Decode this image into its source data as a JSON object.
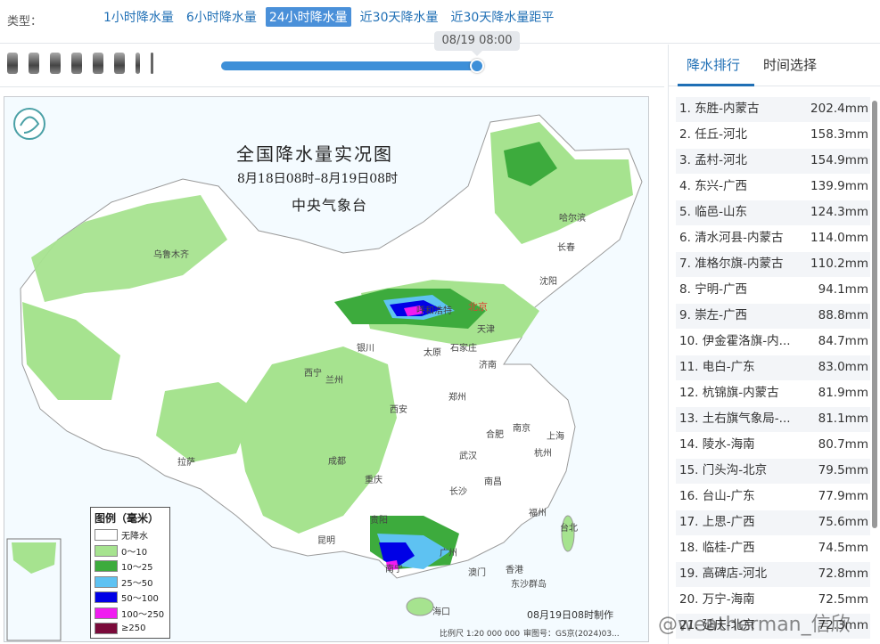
{
  "header": {
    "type_label": "类型：",
    "tabs": [
      {
        "label": "1小时降水量",
        "active": false
      },
      {
        "label": "6小时降水量",
        "active": false
      },
      {
        "label": "24小时降水量",
        "active": true
      },
      {
        "label": "近30天降水量",
        "active": false
      },
      {
        "label": "近30天降水量距平",
        "active": false
      }
    ]
  },
  "timeline": {
    "current_time": "08/19 08:00",
    "progress": 0.99
  },
  "map": {
    "title": "全国降水量实况图",
    "subtitle": "8月18日08时–8月19日08时",
    "agency": "中央气象台",
    "legend_title": "图例（毫米）",
    "legend": [
      {
        "label": "无降水",
        "color": "#ffffff"
      },
      {
        "label": "0～10",
        "color": "#a6e38f"
      },
      {
        "label": "10～25",
        "color": "#3dab3d"
      },
      {
        "label": "25～50",
        "color": "#5ec2f2"
      },
      {
        "label": "50～100",
        "color": "#0000e6"
      },
      {
        "label": "100～250",
        "color": "#f01cf0"
      },
      {
        "label": "≥250",
        "color": "#7a0a3a"
      }
    ],
    "cities": [
      {
        "name": "哈尔滨",
        "cap": false
      },
      {
        "name": "长春",
        "cap": false
      },
      {
        "name": "沈阳",
        "cap": false
      },
      {
        "name": "北京",
        "cap": true
      },
      {
        "name": "天津",
        "cap": false
      },
      {
        "name": "呼和浩特",
        "cap": false
      },
      {
        "name": "石家庄",
        "cap": false
      },
      {
        "name": "太原",
        "cap": false
      },
      {
        "name": "济南",
        "cap": false
      },
      {
        "name": "银川",
        "cap": false
      },
      {
        "name": "西宁",
        "cap": false
      },
      {
        "name": "兰州",
        "cap": false
      },
      {
        "name": "乌鲁木齐",
        "cap": false
      },
      {
        "name": "郑州",
        "cap": false
      },
      {
        "name": "西安",
        "cap": false
      },
      {
        "name": "南京",
        "cap": false
      },
      {
        "name": "合肥",
        "cap": false
      },
      {
        "name": "上海",
        "cap": false
      },
      {
        "name": "武汉",
        "cap": false
      },
      {
        "name": "杭州",
        "cap": false
      },
      {
        "name": "成都",
        "cap": false
      },
      {
        "name": "重庆",
        "cap": false
      },
      {
        "name": "拉萨",
        "cap": false
      },
      {
        "name": "长沙",
        "cap": false
      },
      {
        "name": "南昌",
        "cap": false
      },
      {
        "name": "福州",
        "cap": false
      },
      {
        "name": "台北",
        "cap": false
      },
      {
        "name": "贵阳",
        "cap": false
      },
      {
        "name": "昆明",
        "cap": false
      },
      {
        "name": "南宁",
        "cap": false
      },
      {
        "name": "广州",
        "cap": false
      },
      {
        "name": "澳门",
        "cap": false
      },
      {
        "name": "香港",
        "cap": false
      },
      {
        "name": "海口",
        "cap": false
      },
      {
        "name": "东沙群岛",
        "cap": false
      }
    ],
    "made_time": "08月19日08时制作",
    "scale": "比例尺 1:20 000 000",
    "approval": "审图号：GS京(2024)03..."
  },
  "side": {
    "tabs": [
      {
        "label": "降水排行",
        "active": true
      },
      {
        "label": "时间选择",
        "active": false
      }
    ],
    "ranking": [
      {
        "rank": "1.",
        "name": "东胜-内蒙古",
        "value": "202.4mm"
      },
      {
        "rank": "2.",
        "name": "任丘-河北",
        "value": "158.3mm"
      },
      {
        "rank": "3.",
        "name": "孟村-河北",
        "value": "154.9mm"
      },
      {
        "rank": "4.",
        "name": "东兴-广西",
        "value": "139.9mm"
      },
      {
        "rank": "5.",
        "name": "临邑-山东",
        "value": "124.3mm"
      },
      {
        "rank": "6.",
        "name": "清水河县-内蒙古",
        "value": "114.0mm"
      },
      {
        "rank": "7.",
        "name": "准格尔旗-内蒙古",
        "value": "110.2mm"
      },
      {
        "rank": "8.",
        "name": "宁明-广西",
        "value": "94.1mm"
      },
      {
        "rank": "9.",
        "name": "崇左-广西",
        "value": "88.8mm"
      },
      {
        "rank": "10.",
        "name": "伊金霍洛旗-内...",
        "value": "84.7mm"
      },
      {
        "rank": "11.",
        "name": "电白-广东",
        "value": "83.0mm"
      },
      {
        "rank": "12.",
        "name": "杭锦旗-内蒙古",
        "value": "81.9mm"
      },
      {
        "rank": "13.",
        "name": "土右旗气象局-...",
        "value": "81.1mm"
      },
      {
        "rank": "14.",
        "name": "陵水-海南",
        "value": "80.7mm"
      },
      {
        "rank": "15.",
        "name": "门头沟-北京",
        "value": "79.5mm"
      },
      {
        "rank": "16.",
        "name": "台山-广东",
        "value": "77.9mm"
      },
      {
        "rank": "17.",
        "name": "上思-广西",
        "value": "75.6mm"
      },
      {
        "rank": "18.",
        "name": "临桂-广西",
        "value": "74.5mm"
      },
      {
        "rank": "19.",
        "name": "高碑店-河北",
        "value": "72.8mm"
      },
      {
        "rank": "20.",
        "name": "万宁-海南",
        "value": "72.5mm"
      },
      {
        "rank": "21.",
        "name": "延庆-北京",
        "value": "72.3mm"
      }
    ]
  },
  "watermark": "@weatherman_信欣"
}
